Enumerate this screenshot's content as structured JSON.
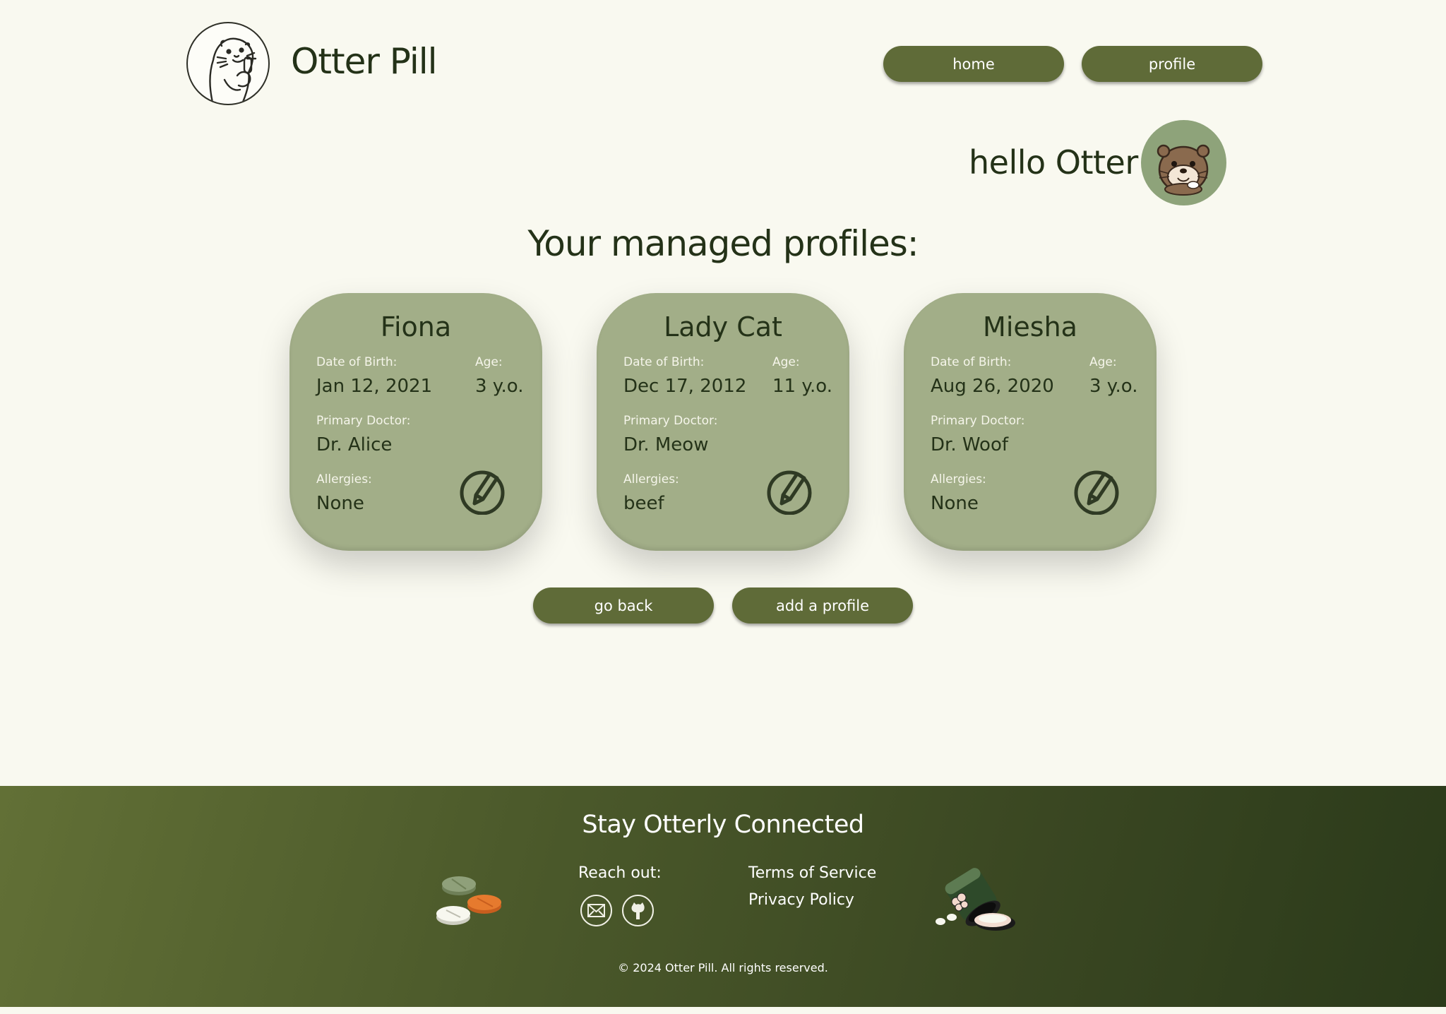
{
  "header": {
    "brand": "Otter Pill",
    "nav": [
      {
        "label": "home"
      },
      {
        "label": "profile"
      }
    ],
    "greeting": "hello Otter"
  },
  "main": {
    "heading": "Your managed profiles:",
    "labels": {
      "dob": "Date of Birth:",
      "age": "Age:",
      "doctor": "Primary Doctor:",
      "allergies": "Allergies:"
    },
    "profiles": [
      {
        "name": "Fiona",
        "dob": "Jan 12, 2021",
        "age": "3 y.o.",
        "doctor": "Dr. Alice",
        "allergies": "None"
      },
      {
        "name": "Lady Cat",
        "dob": "Dec 17, 2012",
        "age": "11 y.o.",
        "doctor": "Dr. Meow",
        "allergies": "beef"
      },
      {
        "name": "Miesha",
        "dob": "Aug 26, 2020",
        "age": "3 y.o.",
        "doctor": "Dr. Woof",
        "allergies": "None"
      }
    ],
    "actions": {
      "back_label": "go back",
      "add_label": "add a profile"
    }
  },
  "footer": {
    "title": "Stay Otterly Connected",
    "reach_out": "Reach out:",
    "social_icons": [
      "email-icon",
      "github-icon"
    ],
    "links": [
      "Terms of Service",
      "Privacy Policy"
    ],
    "copyright": "© 2024 Otter Pill. All rights reserved."
  },
  "colors": {
    "background": "#f9f9f0",
    "button": "#5f6b38",
    "card": "#a2ae88",
    "text_dark": "#243218",
    "footer_start": "#627036",
    "footer_end": "#2b3a1a"
  }
}
